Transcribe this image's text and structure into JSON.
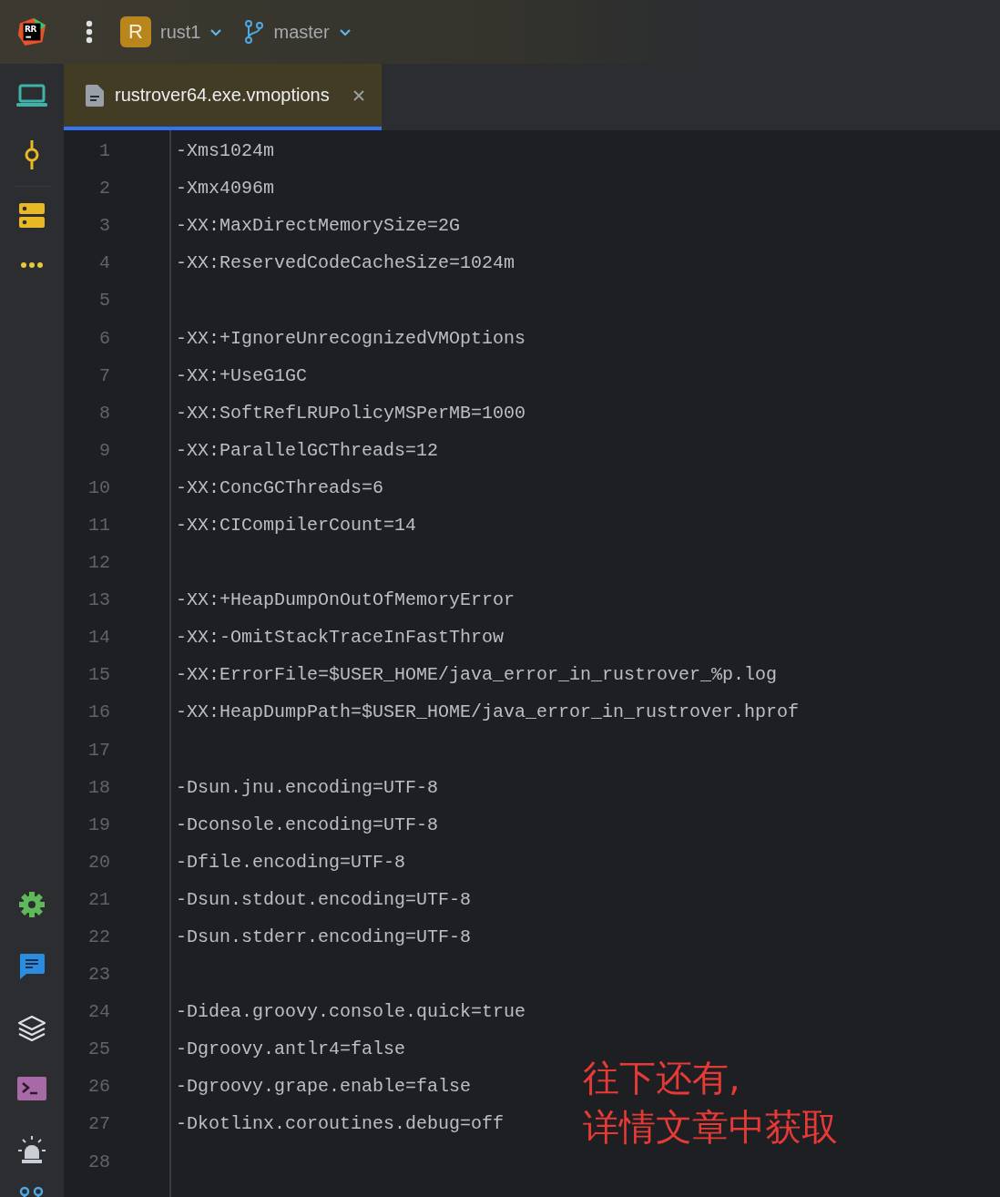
{
  "logo": {
    "text": "RR"
  },
  "project": {
    "avatar": "R",
    "name": "rust1"
  },
  "branch": {
    "name": "master"
  },
  "tabs": [
    {
      "label": "rustrover64.exe.vmoptions",
      "selected": true
    }
  ],
  "editor": {
    "lines": [
      {
        "number": "1",
        "text": "-Xms1024m"
      },
      {
        "number": "2",
        "text": "-Xmx4096m"
      },
      {
        "number": "3",
        "text": "-XX:MaxDirectMemorySize=2G"
      },
      {
        "number": "4",
        "text": "-XX:ReservedCodeCacheSize=1024m"
      },
      {
        "number": "5"
      },
      {
        "number": "6",
        "text": "-XX:+IgnoreUnrecognizedVMOptions"
      },
      {
        "number": "7",
        "text": "-XX:+UseG1GC"
      },
      {
        "number": "8",
        "text": "-XX:SoftRefLRUPolicyMSPerMB=1000"
      },
      {
        "number": "9",
        "text": "-XX:ParallelGCThreads=12"
      },
      {
        "number": "10",
        "text": "-XX:ConcGCThreads=6"
      },
      {
        "number": "11",
        "text": "-XX:CICompilerCount=14"
      },
      {
        "number": "12"
      },
      {
        "number": "13",
        "text": "-XX:+HeapDumpOnOutOfMemoryError"
      },
      {
        "number": "14",
        "text": "-XX:-OmitStackTraceInFastThrow"
      },
      {
        "number": "15",
        "text": "-XX:ErrorFile=$USER_HOME/java_error_in_rustrover_%p.log"
      },
      {
        "number": "16",
        "text": "-XX:HeapDumpPath=$USER_HOME/java_error_in_rustrover.hprof"
      },
      {
        "number": "17"
      },
      {
        "number": "18",
        "text": "-Dsun.jnu.encoding=UTF-8"
      },
      {
        "number": "19",
        "text": "-Dconsole.encoding=UTF-8"
      },
      {
        "number": "20",
        "text": "-Dfile.encoding=UTF-8"
      },
      {
        "number": "21",
        "text": "-Dsun.stdout.encoding=UTF-8"
      },
      {
        "number": "22",
        "text": "-Dsun.stderr.encoding=UTF-8"
      },
      {
        "number": "23"
      },
      {
        "number": "24",
        "text": "-Didea.groovy.console.quick=true"
      },
      {
        "number": "25",
        "text": "-Dgroovy.antlr4=false"
      },
      {
        "number": "26",
        "text": "-Dgroovy.grape.enable=false"
      },
      {
        "number": "27",
        "text": "-Dkotlinx.coroutines.debug=off"
      },
      {
        "number": "28"
      }
    ]
  },
  "annotation": {
    "lines": [
      "往下还有,",
      "详情文章中获取"
    ]
  }
}
